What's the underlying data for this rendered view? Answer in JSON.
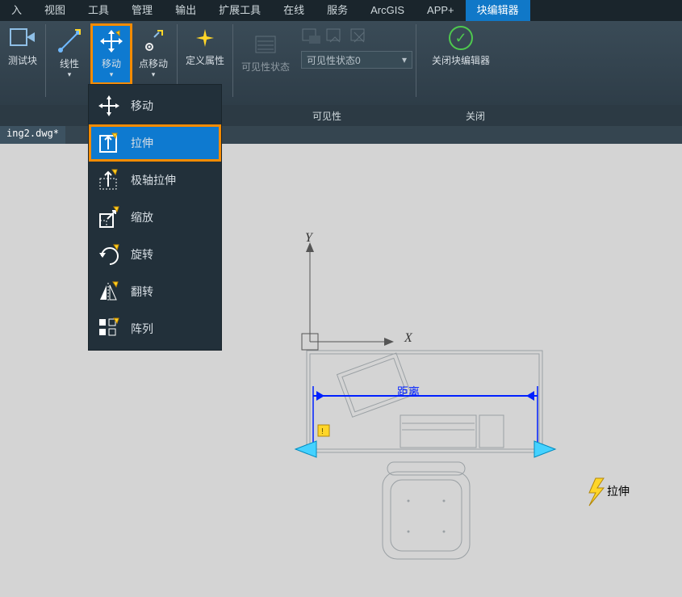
{
  "menu": {
    "view": "视图",
    "tools": "工具",
    "manage": "管理",
    "output": "输出",
    "ext": "扩展工具",
    "online": "在线",
    "service": "服务",
    "arcgis": "ArcGIS",
    "app": "APP+",
    "blockedit": "块编辑器",
    "insert": "入"
  },
  "ribbon": {
    "test": "测试块",
    "linear": "线性",
    "move": "移动",
    "pointmove": "点移动",
    "defattr": "定义属性",
    "visstate": "可见性状态",
    "visdropdown": "可见性状态0",
    "closeeditor": "关闭块编辑器"
  },
  "panel_labels": {
    "visibility": "可见性",
    "close": "关闭"
  },
  "dropdown": [
    "移动",
    "拉伸",
    "极轴拉伸",
    "缩放",
    "旋转",
    "翻转",
    "阵列"
  ],
  "doc_tab": "ing2.dwg*",
  "canvas": {
    "y": "Y",
    "x": "X",
    "dim": "距离",
    "tooltip": "拉伸"
  },
  "colors": {
    "accent": "#0e7ad0",
    "highlight": "#f58b00",
    "lightbolt": "#ffd628",
    "dim": "#0020ff"
  }
}
